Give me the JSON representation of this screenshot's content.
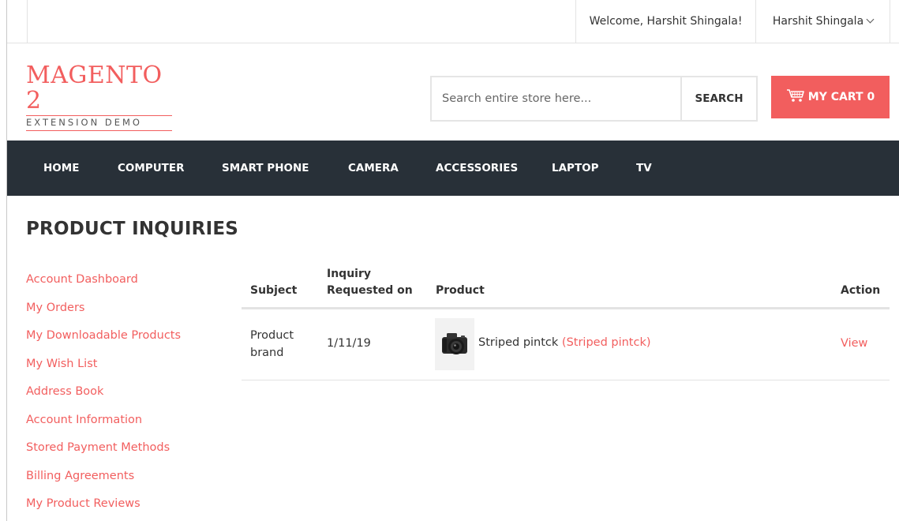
{
  "header": {
    "welcome": "Welcome, Harshit Shingala!",
    "user_name": "Harshit Shingala"
  },
  "logo": {
    "line1": "MAGENTO 2",
    "line2": "EXTENSION DEMO"
  },
  "search": {
    "placeholder": "Search entire store here...",
    "button": "SEARCH"
  },
  "cart": {
    "label": "MY CART",
    "count": "0"
  },
  "nav": {
    "items": [
      "HOME",
      "COMPUTER",
      "SMART PHONE",
      "CAMERA",
      "ACCESSORIES",
      "LAPTOP",
      "TV"
    ]
  },
  "page": {
    "title": "PRODUCT INQUIRIES"
  },
  "sidebar": {
    "items": [
      "Account Dashboard",
      "My Orders",
      "My Downloadable Products",
      "My Wish List",
      "Address Book",
      "Account Information",
      "Stored Payment Methods",
      "Billing Agreements",
      "My Product Reviews"
    ]
  },
  "table": {
    "headers": {
      "subject": "Subject",
      "requested_line1": "Inquiry",
      "requested_line2": "Requested on",
      "product": "Product",
      "action": "Action"
    },
    "rows": [
      {
        "subject_line1": "Product",
        "subject_line2": "brand",
        "date": "1/11/19",
        "product_name": "Striped pintck",
        "product_sku": "(Striped pintck)",
        "action": "View"
      }
    ]
  },
  "colors": {
    "accent": "#f25e5e",
    "nav_bg": "#283038"
  },
  "icons": [
    "chevron-down-icon",
    "cart-icon",
    "camera-thumbnail"
  ]
}
